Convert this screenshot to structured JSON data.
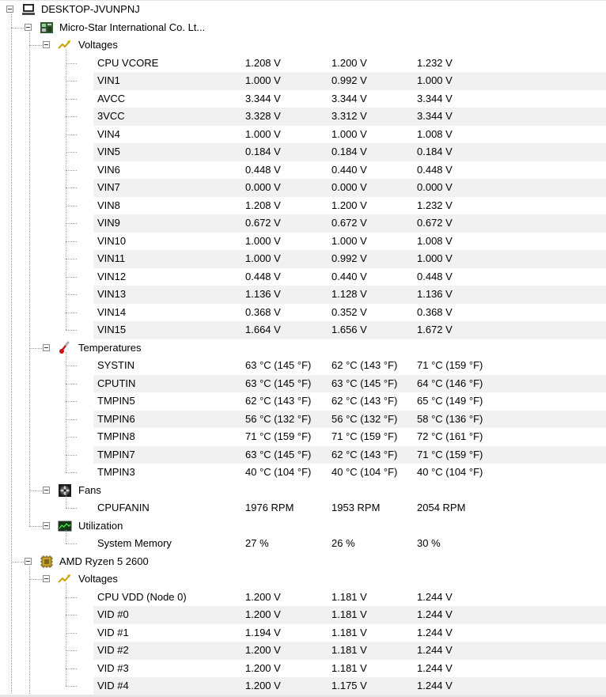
{
  "computer": {
    "name": "DESKTOP-JVUNPNJ",
    "icon": "computer-icon"
  },
  "devices": [
    {
      "name": "Micro-Star International Co. Lt...",
      "icon": "motherboard-icon",
      "groups": [
        {
          "name": "Voltages",
          "icon": "voltage-icon",
          "sensors": [
            {
              "name": "CPU VCORE",
              "value": "1.208 V",
              "min": "1.200 V",
              "max": "1.232 V"
            },
            {
              "name": "VIN1",
              "value": "1.000 V",
              "min": "0.992 V",
              "max": "1.000 V"
            },
            {
              "name": "AVCC",
              "value": "3.344 V",
              "min": "3.344 V",
              "max": "3.344 V"
            },
            {
              "name": "3VCC",
              "value": "3.328 V",
              "min": "3.312 V",
              "max": "3.344 V"
            },
            {
              "name": "VIN4",
              "value": "1.000 V",
              "min": "1.000 V",
              "max": "1.008 V"
            },
            {
              "name": "VIN5",
              "value": "0.184 V",
              "min": "0.184 V",
              "max": "0.184 V"
            },
            {
              "name": "VIN6",
              "value": "0.448 V",
              "min": "0.440 V",
              "max": "0.448 V"
            },
            {
              "name": "VIN7",
              "value": "0.000 V",
              "min": "0.000 V",
              "max": "0.000 V"
            },
            {
              "name": "VIN8",
              "value": "1.208 V",
              "min": "1.200 V",
              "max": "1.232 V"
            },
            {
              "name": "VIN9",
              "value": "0.672 V",
              "min": "0.672 V",
              "max": "0.672 V"
            },
            {
              "name": "VIN10",
              "value": "1.000 V",
              "min": "1.000 V",
              "max": "1.008 V"
            },
            {
              "name": "VIN11",
              "value": "1.000 V",
              "min": "0.992 V",
              "max": "1.000 V"
            },
            {
              "name": "VIN12",
              "value": "0.448 V",
              "min": "0.440 V",
              "max": "0.448 V"
            },
            {
              "name": "VIN13",
              "value": "1.136 V",
              "min": "1.128 V",
              "max": "1.136 V"
            },
            {
              "name": "VIN14",
              "value": "0.368 V",
              "min": "0.352 V",
              "max": "0.368 V"
            },
            {
              "name": "VIN15",
              "value": "1.664 V",
              "min": "1.656 V",
              "max": "1.672 V"
            }
          ]
        },
        {
          "name": "Temperatures",
          "icon": "thermometer-icon",
          "sensors": [
            {
              "name": "SYSTIN",
              "value": "63 °C  (145 °F)",
              "min": "62 °C  (143 °F)",
              "max": "71 °C  (159 °F)"
            },
            {
              "name": "CPUTIN",
              "value": "63 °C  (145 °F)",
              "min": "63 °C  (145 °F)",
              "max": "64 °C  (146 °F)"
            },
            {
              "name": "TMPIN5",
              "value": "62 °C  (143 °F)",
              "min": "62 °C  (143 °F)",
              "max": "65 °C  (149 °F)"
            },
            {
              "name": "TMPIN6",
              "value": "56 °C  (132 °F)",
              "min": "56 °C  (132 °F)",
              "max": "58 °C  (136 °F)"
            },
            {
              "name": "TMPIN8",
              "value": "71 °C  (159 °F)",
              "min": "71 °C  (159 °F)",
              "max": "72 °C  (161 °F)"
            },
            {
              "name": "TMPIN7",
              "value": "63 °C  (145 °F)",
              "min": "62 °C  (143 °F)",
              "max": "71 °C  (159 °F)"
            },
            {
              "name": "TMPIN3",
              "value": "40 °C  (104 °F)",
              "min": "40 °C  (104 °F)",
              "max": "40 °C  (104 °F)"
            }
          ]
        },
        {
          "name": "Fans",
          "icon": "fan-icon",
          "sensors": [
            {
              "name": "CPUFANIN",
              "value": "1976 RPM",
              "min": "1953 RPM",
              "max": "2054 RPM"
            }
          ]
        },
        {
          "name": "Utilization",
          "icon": "utilization-icon",
          "sensors": [
            {
              "name": "System Memory",
              "value": "27 %",
              "min": "26 %",
              "max": "30 %"
            }
          ]
        }
      ]
    },
    {
      "name": "AMD Ryzen 5 2600",
      "icon": "cpu-chip-icon",
      "groups": [
        {
          "name": "Voltages",
          "icon": "voltage-icon",
          "sensors": [
            {
              "name": "CPU VDD (Node 0)",
              "value": "1.200 V",
              "min": "1.181 V",
              "max": "1.244 V"
            },
            {
              "name": "VID #0",
              "value": "1.200 V",
              "min": "1.181 V",
              "max": "1.244 V"
            },
            {
              "name": "VID #1",
              "value": "1.194 V",
              "min": "1.181 V",
              "max": "1.244 V"
            },
            {
              "name": "VID #2",
              "value": "1.200 V",
              "min": "1.181 V",
              "max": "1.244 V"
            },
            {
              "name": "VID #3",
              "value": "1.200 V",
              "min": "1.181 V",
              "max": "1.244 V"
            },
            {
              "name": "VID #4",
              "value": "1.200 V",
              "min": "1.175 V",
              "max": "1.244 V"
            }
          ]
        }
      ]
    }
  ]
}
